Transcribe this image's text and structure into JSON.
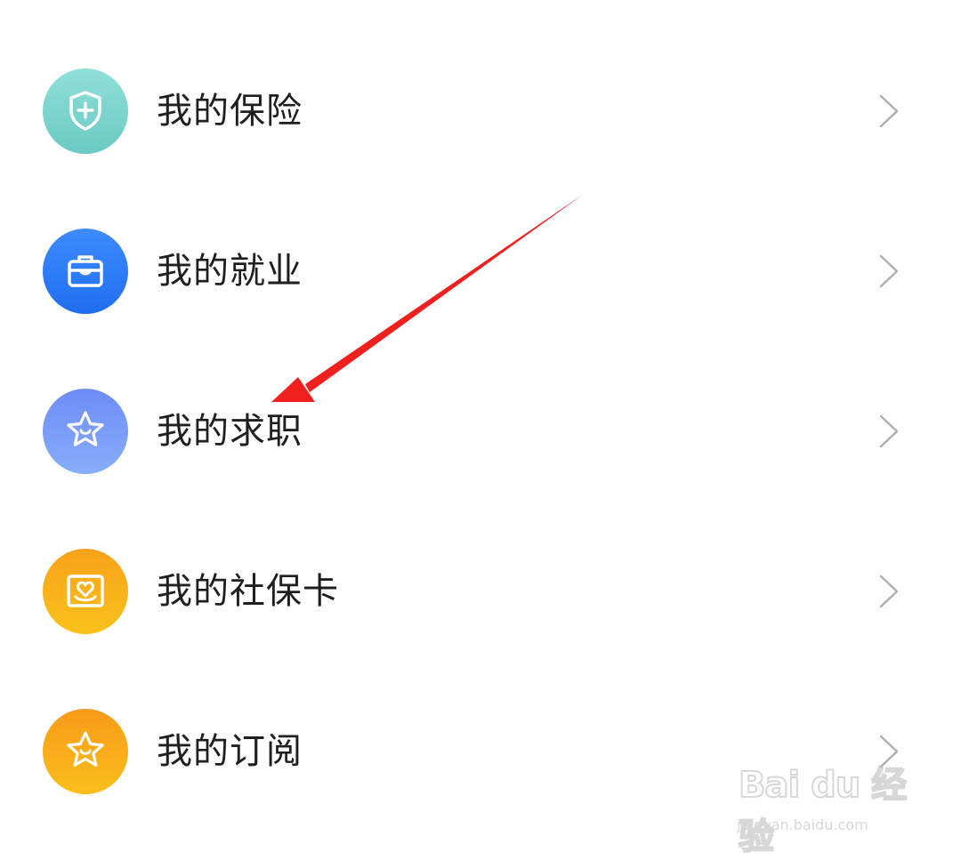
{
  "menu": {
    "items": [
      {
        "label": "我的保险",
        "icon": "shield-plus-icon",
        "color_top": "#8fe0d8",
        "color_bottom": "#6cc9c4"
      },
      {
        "label": "我的就业",
        "icon": "briefcase-icon",
        "color_top": "#3e8bff",
        "color_bottom": "#1f6ef0"
      },
      {
        "label": "我的求职",
        "icon": "star-smile-icon",
        "color_top": "#6e8cf8",
        "color_bottom": "#86aef8"
      },
      {
        "label": "我的社保卡",
        "icon": "card-heart-icon",
        "color_top": "#f7a21a",
        "color_bottom": "#fbc21b"
      },
      {
        "label": "我的订阅",
        "icon": "star-smile-icon",
        "color_top": "#f89a18",
        "color_bottom": "#fbbf1c"
      }
    ]
  },
  "colors": {
    "label": "#1f1f1f",
    "chevron": "#b0b0b0",
    "annotation_arrow": "#f0201e"
  },
  "watermark": {
    "brand": "Bai du 经验",
    "url": "jingyan.baidu.com"
  }
}
